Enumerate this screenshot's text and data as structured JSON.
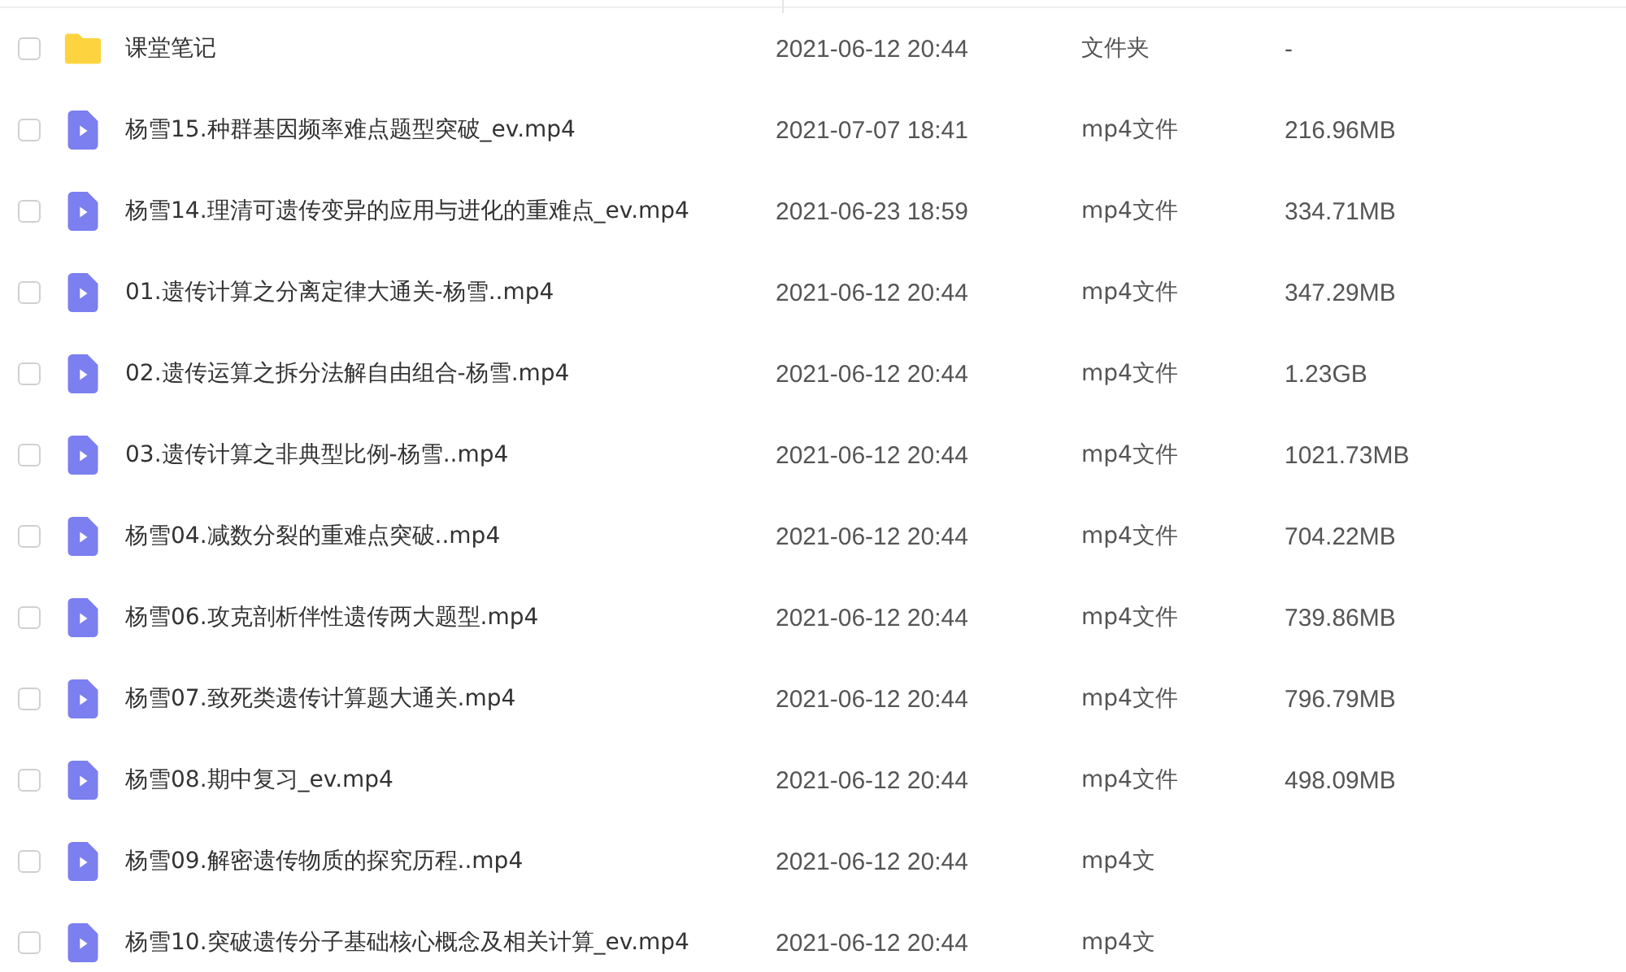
{
  "files": [
    {
      "kind": "folder",
      "name": "课堂笔记",
      "modified": "2021-06-12 20:44",
      "type": "文件夹",
      "size": "-",
      "checked": false
    },
    {
      "kind": "video",
      "name": "杨雪15.种群基因频率难点题型突破_ev.mp4",
      "modified": "2021-07-07 18:41",
      "type": "mp4文件",
      "size": "216.96MB",
      "checked": false
    },
    {
      "kind": "video",
      "name": "杨雪14.理清可遗传变异的应用与进化的重难点_ev.mp4",
      "modified": "2021-06-23 18:59",
      "type": "mp4文件",
      "size": "334.71MB",
      "checked": false
    },
    {
      "kind": "video",
      "name": "01.遗传计算之分离定律大通关-杨雪..mp4",
      "modified": "2021-06-12 20:44",
      "type": "mp4文件",
      "size": "347.29MB",
      "checked": false
    },
    {
      "kind": "video",
      "name": "02.遗传运算之拆分法解自由组合-杨雪.mp4",
      "modified": "2021-06-12 20:44",
      "type": "mp4文件",
      "size": "1.23GB",
      "checked": false
    },
    {
      "kind": "video",
      "name": "03.遗传计算之非典型比例-杨雪..mp4",
      "modified": "2021-06-12 20:44",
      "type": "mp4文件",
      "size": "1021.73MB",
      "checked": false
    },
    {
      "kind": "video",
      "name": "杨雪04.减数分裂的重难点突破..mp4",
      "modified": "2021-06-12 20:44",
      "type": "mp4文件",
      "size": "704.22MB",
      "checked": false
    },
    {
      "kind": "video",
      "name": "杨雪06.攻克剖析伴性遗传两大题型.mp4",
      "modified": "2021-06-12 20:44",
      "type": "mp4文件",
      "size": "739.86MB",
      "checked": false
    },
    {
      "kind": "video",
      "name": "杨雪07.致死类遗传计算题大通关.mp4",
      "modified": "2021-06-12 20:44",
      "type": "mp4文件",
      "size": "796.79MB",
      "checked": false
    },
    {
      "kind": "video",
      "name": "杨雪08.期中复习_ev.mp4",
      "modified": "2021-06-12 20:44",
      "type": "mp4文件",
      "size": "498.09MB",
      "checked": false
    },
    {
      "kind": "video",
      "name": "杨雪09.解密遗传物质的探究历程..mp4",
      "modified": "2021-06-12 20:44",
      "type": "mp4文",
      "checked": false
    },
    {
      "kind": "video",
      "name": "杨雪10.突破遗传分子基础核心概念及相关计算_ev.mp4",
      "modified": "2021-06-12 20:44",
      "type": "mp4文",
      "checked": false
    }
  ]
}
